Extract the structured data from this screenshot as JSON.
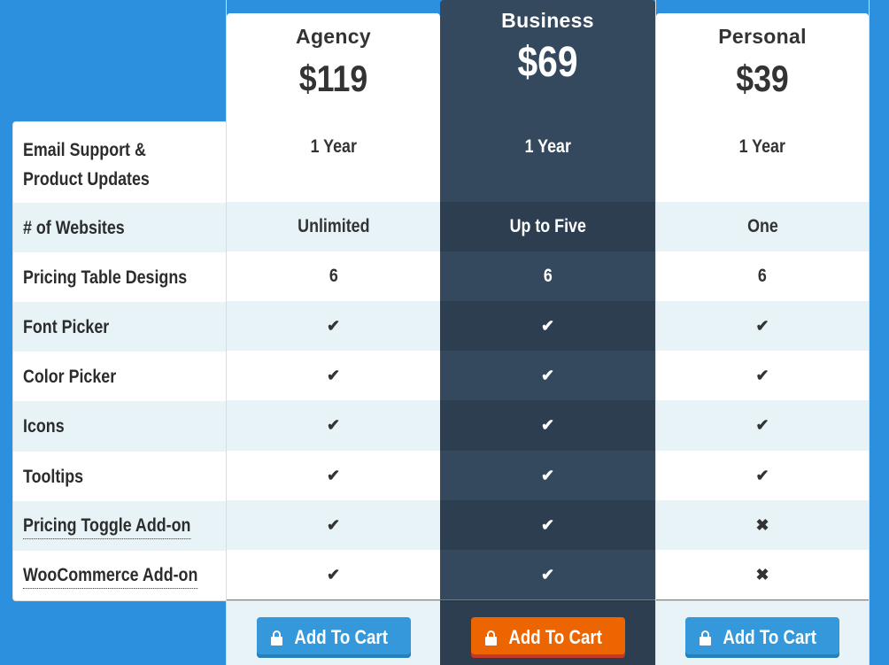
{
  "colors": {
    "background": "#2d90df",
    "featured_column": "#34495e",
    "featured_column_alt": "#2d3e50",
    "row_alt": "#e8f3f8",
    "button_blue": "#3498db",
    "button_orange": "#ec6500"
  },
  "features": [
    {
      "label": "Email Support & Product Updates",
      "tooltip": false
    },
    {
      "label": "# of Websites",
      "tooltip": false
    },
    {
      "label": "Pricing Table Designs",
      "tooltip": false
    },
    {
      "label": "Font Picker",
      "tooltip": false
    },
    {
      "label": "Color Picker",
      "tooltip": false
    },
    {
      "label": "Icons",
      "tooltip": false
    },
    {
      "label": "Tooltips",
      "tooltip": false
    },
    {
      "label": "Pricing Toggle Add-on",
      "tooltip": true
    },
    {
      "label": "WooCommerce Add-on",
      "tooltip": true
    }
  ],
  "plans": [
    {
      "name": "Agency",
      "price": "$119",
      "featured": false,
      "values": [
        "1 Year",
        "Unlimited",
        "6",
        "check-icon",
        "check-icon",
        "check-icon",
        "check-icon",
        "check-icon",
        "check-icon"
      ],
      "button": {
        "label": "Add To Cart",
        "icon": "lock-icon"
      }
    },
    {
      "name": "Business",
      "price": "$69",
      "featured": true,
      "values": [
        "1 Year",
        "Up to Five",
        "6",
        "check-icon",
        "check-icon",
        "check-icon",
        "check-icon",
        "check-icon",
        "check-icon"
      ],
      "button": {
        "label": "Add To Cart",
        "icon": "lock-icon"
      }
    },
    {
      "name": "Personal",
      "price": "$39",
      "featured": false,
      "values": [
        "1 Year",
        "One",
        "6",
        "check-icon",
        "check-icon",
        "check-icon",
        "check-icon",
        "cross-icon",
        "cross-icon"
      ],
      "button": {
        "label": "Add To Cart",
        "icon": "lock-icon"
      }
    }
  ],
  "icons": {
    "check-icon": "✔",
    "cross-icon": "✖"
  }
}
